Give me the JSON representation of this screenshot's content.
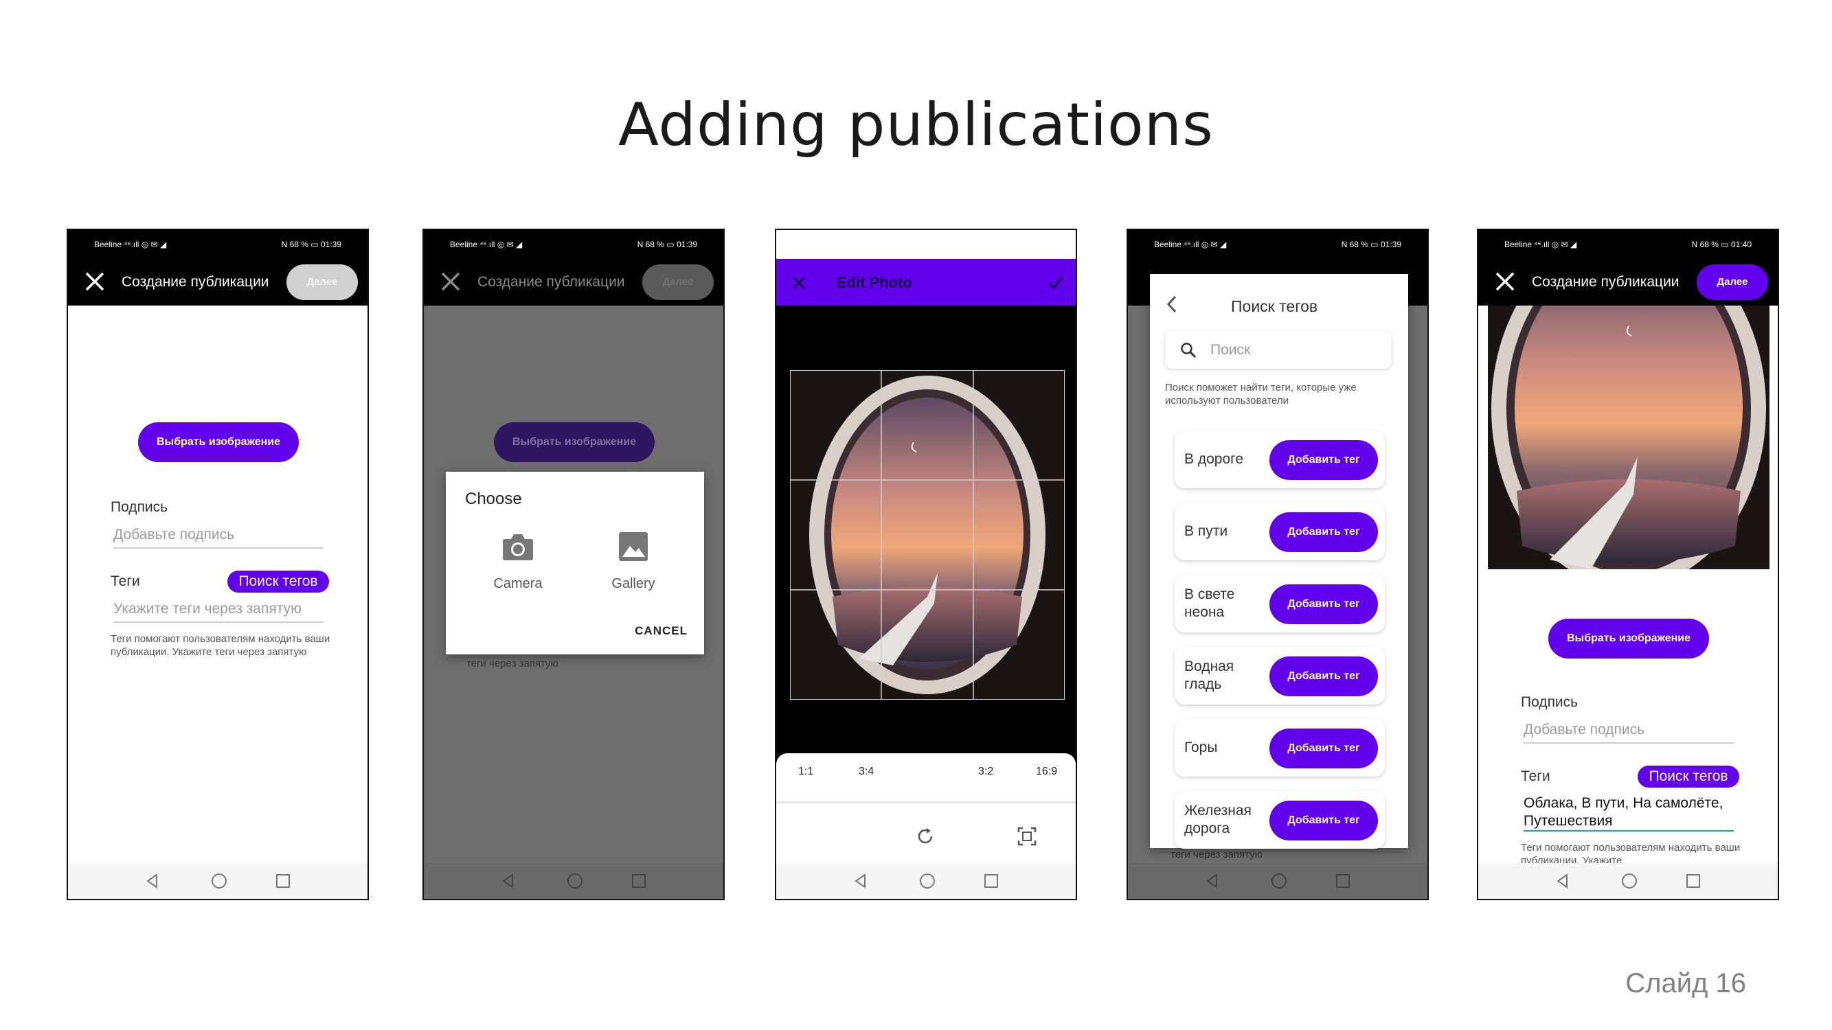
{
  "slide": {
    "title": "Adding publications",
    "number": "Слайд 16"
  },
  "screens": {
    "s1": {
      "status_left": "Beeline ⁴⁶.ıll ◎ ✉ ◢",
      "status_right": "N 68 % ▭ 01:39",
      "title": "Создание публикации",
      "next": "Далее",
      "choose_image": "Выбрать изображение",
      "caption_label": "Подпись",
      "caption_placeholder": "Добавьте подпись",
      "tags_label": "Теги",
      "search_tags": "Поиск тегов",
      "tags_placeholder": "Укажите теги через запятую",
      "tags_hint": "Теги помогают пользователям находить ваши публикации. Укажите теги через запятую"
    },
    "s2": {
      "status_left": "Beeline ⁴⁶.ıll ◎ ✉ ◢",
      "status_right": "N 68 % ▭ 01:39",
      "title": "Создание публикации",
      "next": "Далее",
      "choose_image": "Выбрать изображение",
      "dialog_title": "Choose",
      "camera": "Camera",
      "gallery": "Gallery",
      "cancel": "CANCEL",
      "hint_tail": "теги через запятую"
    },
    "s3": {
      "title": "Edit Photo",
      "ratios": [
        "1:1",
        "3:4",
        "3:2",
        "16:9"
      ]
    },
    "s4": {
      "status_left": "Beeline ⁴⁶.ıll ◎ ✉ ◢",
      "status_right": "N 68 % ▭ 01:39",
      "title": "Поиск тегов",
      "search_placeholder": "Поиск",
      "hint": "Поиск поможет найти теги, которые уже используют пользователи",
      "add_label": "Добавить тег",
      "tags": [
        "В дороге",
        "В пути",
        "В свете неона",
        "Водная гладь",
        "Горы",
        "Железная дорога"
      ],
      "bottom_tail": "теги через запятую"
    },
    "s5": {
      "status_left": "Beeline ⁴⁶.ıll ◎ ✉ ◢",
      "status_right": "N 68 % ▭ 01:40",
      "title": "Создание публикации",
      "next": "Далее",
      "choose_image": "Выбрать изображение",
      "caption_label": "Подпись",
      "caption_placeholder": "Добавьте подпись",
      "tags_label": "Теги",
      "search_tags": "Поиск тегов",
      "tags_value": "Облака, В пути, На самолёте, Путешествия",
      "tags_hint": "Теги помогают пользователям находить ваши публикации. Укажите"
    }
  },
  "colors": {
    "accent": "#6200ee",
    "dim": "#6e6e6e"
  },
  "icons": [
    "close-icon",
    "back-icon",
    "search-icon",
    "camera-icon",
    "gallery-icon",
    "check-icon",
    "rotate-icon",
    "crop-fit-icon",
    "nav-back-icon",
    "nav-home-icon",
    "nav-recent-icon"
  ]
}
